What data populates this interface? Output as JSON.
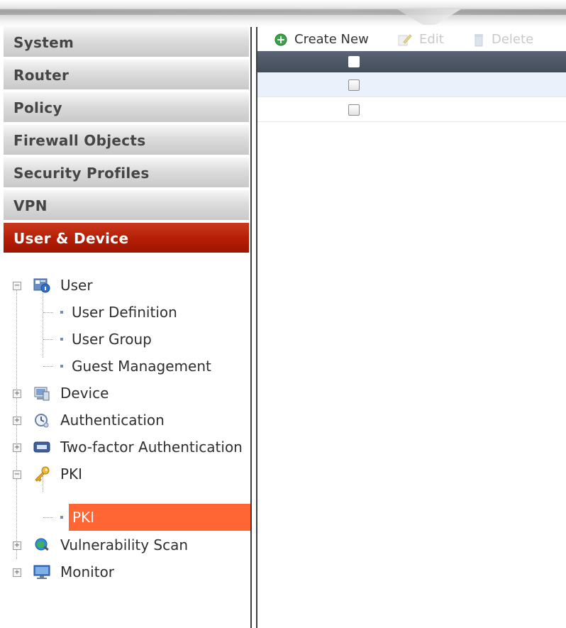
{
  "nav": {
    "items": [
      {
        "label": "System"
      },
      {
        "label": "Router"
      },
      {
        "label": "Policy"
      },
      {
        "label": "Firewall Objects"
      },
      {
        "label": "Security Profiles"
      },
      {
        "label": "VPN"
      },
      {
        "label": "User & Device",
        "active": true
      }
    ]
  },
  "tree": {
    "user": {
      "label": "User",
      "children": [
        "User Definition",
        "User Group",
        "Guest Management"
      ]
    },
    "device": {
      "label": "Device"
    },
    "authentication": {
      "label": "Authentication"
    },
    "two_factor": {
      "label": "Two-factor Authentication"
    },
    "pki": {
      "label": "PKI",
      "children": [
        "PKI"
      ]
    },
    "vulnerability": {
      "label": "Vulnerability Scan"
    },
    "monitor": {
      "label": "Monitor"
    }
  },
  "toolbar": {
    "create_label": "Create New",
    "edit_label": "Edit",
    "delete_label": "Delete"
  },
  "table": {
    "rows": [
      {
        "checked": false
      },
      {
        "checked": false
      }
    ]
  },
  "colors": {
    "active_nav": "#b51d05",
    "selected_tree": "#ff6633",
    "header_bar": "#4b5565",
    "row_alt": "#eaf1fa"
  }
}
